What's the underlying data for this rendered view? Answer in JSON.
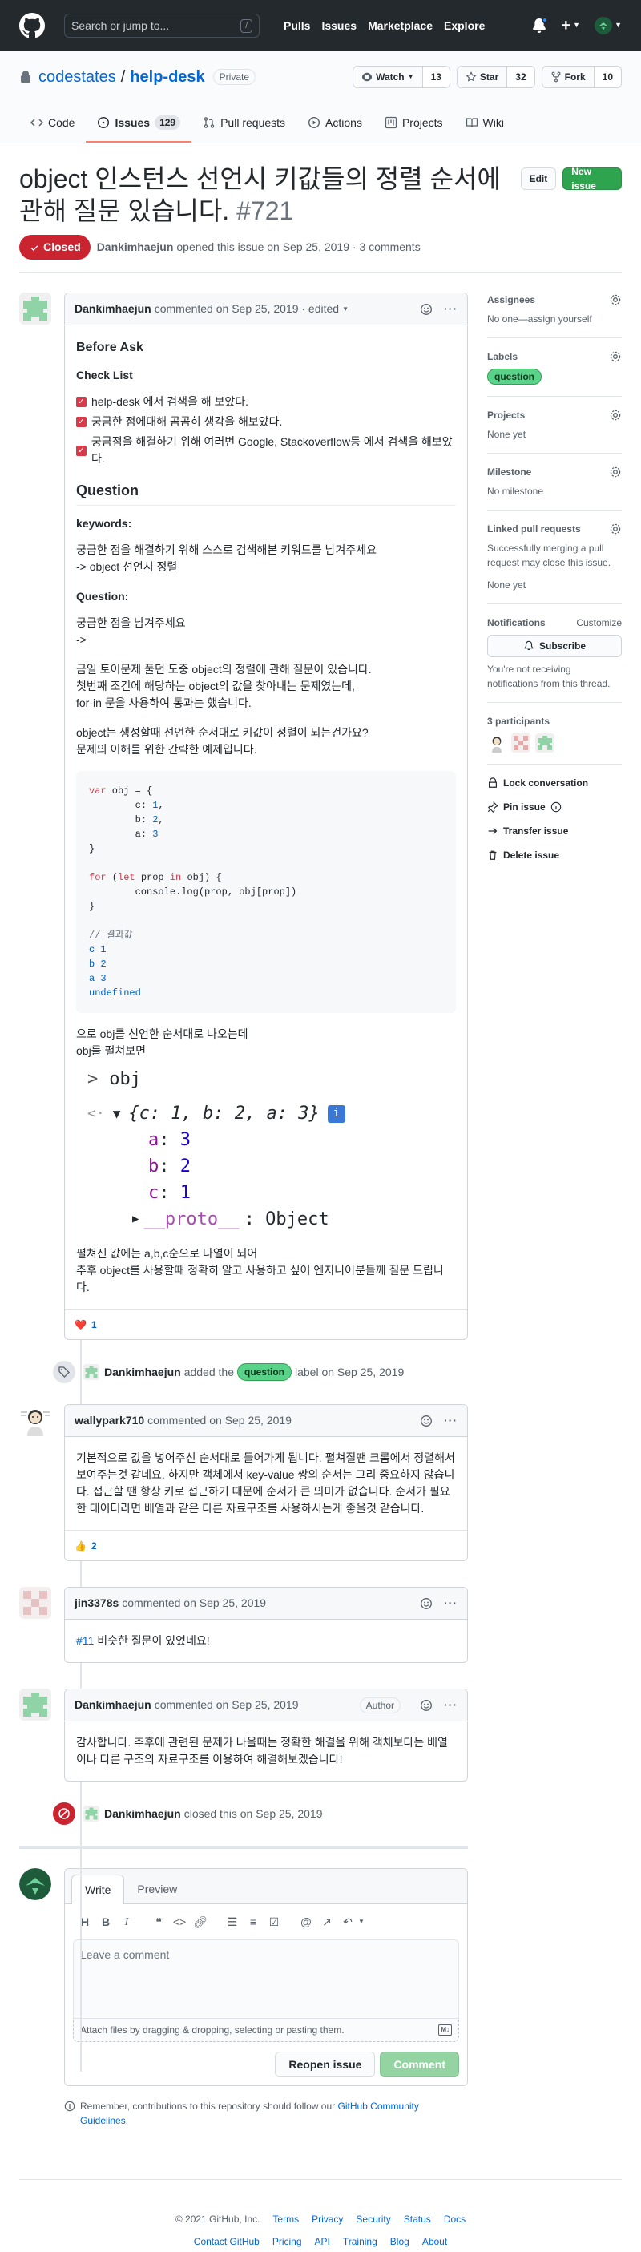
{
  "header": {
    "search_placeholder": "Search or jump to...",
    "search_shortcut": "/",
    "nav": [
      "Pulls",
      "Issues",
      "Marketplace",
      "Explore"
    ]
  },
  "repo": {
    "owner": "codestates",
    "name": "help-desk",
    "visibility": "Private",
    "watch_label": "Watch",
    "watch_count": "13",
    "star_label": "Star",
    "star_count": "32",
    "fork_label": "Fork",
    "fork_count": "10",
    "tabs": [
      {
        "label": "Code"
      },
      {
        "label": "Issues",
        "count": "129"
      },
      {
        "label": "Pull requests"
      },
      {
        "label": "Actions"
      },
      {
        "label": "Projects"
      },
      {
        "label": "Wiki"
      }
    ]
  },
  "issue": {
    "title": "object 인스턴스 선언시 키값들의 정렬 순서에 관해 질문 있습니다.",
    "number": "#721",
    "edit_label": "Edit",
    "new_issue_label": "New issue",
    "state": "Closed",
    "author": "Dankimhaejun",
    "meta_text": "opened this issue on Sep 25, 2019 · 3 comments"
  },
  "comments": [
    {
      "author": "Dankimhaejun",
      "meta": "commented on Sep 25, 2019 · edited",
      "before_ask": "Before Ask",
      "checklist_title": "Check List",
      "checklist": [
        "help-desk 에서 검색을 해 보았다.",
        "궁금한 점에대해 곰곰히 생각을 해보았다.",
        "궁금점을 해결하기 위해 여러번 Google, Stackoverflow등 에서 검색을 해보았다."
      ],
      "question_heading": "Question",
      "keywords_label": "keywords:",
      "keywords_text_1": "궁금한 점을 해결하기 위해 스스로 검색해본 키워드를 남겨주세요",
      "keywords_text_2": "-> object 선언시 정렬",
      "question_label": "Question:",
      "question_text_1": "궁금한 점을 남겨주세요",
      "question_text_2": "->",
      "para1_l1": "금일 토이문제 풀던 도중 object의 정렬에 관해 질문이 있습니다.",
      "para1_l2": "첫번째 조건에 해당하는 object의 값을 찾아내는 문제였는데,",
      "para1_l3": "for-in 문을 사용하여 통과는 했습니다.",
      "para2_l1": "object는 생성할때 선언한 순서대로 키값이 정렬이 되는건가요?",
      "para2_l2": "문제의 이해를 위한 간략한 예제입니다.",
      "code": {
        "line1_kw": "var",
        "line1_rest": " obj = {",
        "prop_c": "c",
        "val_c": "1",
        "prop_b": "b",
        "val_b": "2",
        "prop_a": "a",
        "val_a": "3",
        "for_kw": "for",
        "let_kw": "let",
        "in_kw": "in",
        "for_rest_1": " (",
        "for_rest_2": " prop ",
        "for_rest_3": " obj) {",
        "console_line": "        console.log(prop, obj[prop])",
        "comment": "// 결과값",
        "out1": "c 1",
        "out2": "b 2",
        "out3": "a 3",
        "out4": "undefined"
      },
      "after_code_1": "으로 obj를 선언한 순서대로 나오는데",
      "after_code_2": "obj를 펼쳐보면",
      "console": {
        "prompt": ">",
        "input": "obj",
        "result_arrow": "<·",
        "result_obj": "{c: 1, b: 2, a: 3}",
        "info": "i",
        "props": [
          {
            "key": "a",
            "value": "3"
          },
          {
            "key": "b",
            "value": "2"
          },
          {
            "key": "c",
            "value": "1"
          }
        ],
        "proto": "__proto__",
        "proto_val": ": Object"
      },
      "closing_1": "펼쳐진 값에는 a,b,c순으로 나열이 되어",
      "closing_2": "추후 object를 사용할때 정확히 알고 사용하고 싶어 엔지니어분들께 질문 드립니다.",
      "reaction_emoji": "❤️",
      "reaction_count": "1"
    },
    {
      "author": "wallypark710",
      "meta": "commented on Sep 25, 2019",
      "body": "기본적으로 값을 넣어주신 순서대로 들어가게 됩니다. 펼쳐질땐 크롬에서 정렬해서 보여주는것 같네요. 하지만 객체에서 key-value 쌍의 순서는 그리 중요하지 않습니다. 접근할 땐 항상 키로 접근하기 때문에 순서가 큰 의미가 없습니다. 순서가 필요한 데이터라면 배열과 같은 다른 자료구조를 사용하시는게 좋을것 같습니다.",
      "reaction_emoji": "👍",
      "reaction_count": "2"
    },
    {
      "author": "jin3378s",
      "meta": "commented on Sep 25, 2019",
      "link": "#11",
      "body": " 비슷한 질문이 있었네요!"
    },
    {
      "author": "Dankimhaejun",
      "meta": "commented on Sep 25, 2019",
      "badge": "Author",
      "body": "감사합니다. 추후에 관련된 문제가 나올때는 정확한 해결을 위해 객체보다는 배열이나 다른 구조의 자료구조를 이용하여 해결해보겠습니다!"
    }
  ],
  "events": {
    "labeled": {
      "who": "Dankimhaejun",
      "pre": "added the",
      "label": "question",
      "post": "label on Sep 25, 2019"
    },
    "closed": {
      "who": "Dankimhaejun",
      "text": "closed this on Sep 25, 2019"
    }
  },
  "form": {
    "tab_write": "Write",
    "tab_preview": "Preview",
    "placeholder": "Leave a comment",
    "attach_text": "Attach files by dragging & dropping, selecting or pasting them.",
    "reopen_label": "Reopen issue",
    "comment_label": "Comment",
    "tip_text": "Remember, contributions to this repository should follow our",
    "tip_link": "GitHub Community Guidelines",
    "tip_end": "."
  },
  "sidebar": {
    "assignees_title": "Assignees",
    "assignees_value": "No one—assign yourself",
    "labels_title": "Labels",
    "labels_value": "question",
    "projects_title": "Projects",
    "projects_value": "None yet",
    "milestone_title": "Milestone",
    "milestone_value": "No milestone",
    "linked_title": "Linked pull requests",
    "linked_desc": "Successfully merging a pull request may close this issue.",
    "linked_value": "None yet",
    "notifications_title": "Notifications",
    "customize": "Customize",
    "subscribe_label": "Subscribe",
    "notif_desc": "You're not receiving notifications from this thread.",
    "participants_title": "3 participants",
    "actions": [
      "Lock conversation",
      "Pin issue",
      "Transfer issue",
      "Delete issue"
    ]
  },
  "footer": {
    "copyright": "© 2021 GitHub, Inc.",
    "row1": [
      "Terms",
      "Privacy",
      "Security",
      "Status",
      "Docs"
    ],
    "row2": [
      "Contact GitHub",
      "Pricing",
      "API",
      "Training",
      "Blog",
      "About"
    ]
  },
  "colors": {
    "accent": "#0366d6",
    "closed": "#cb2431",
    "green": "#2ea44f",
    "label_question": "#5ad28a",
    "tab_underline": "#f9826c"
  }
}
